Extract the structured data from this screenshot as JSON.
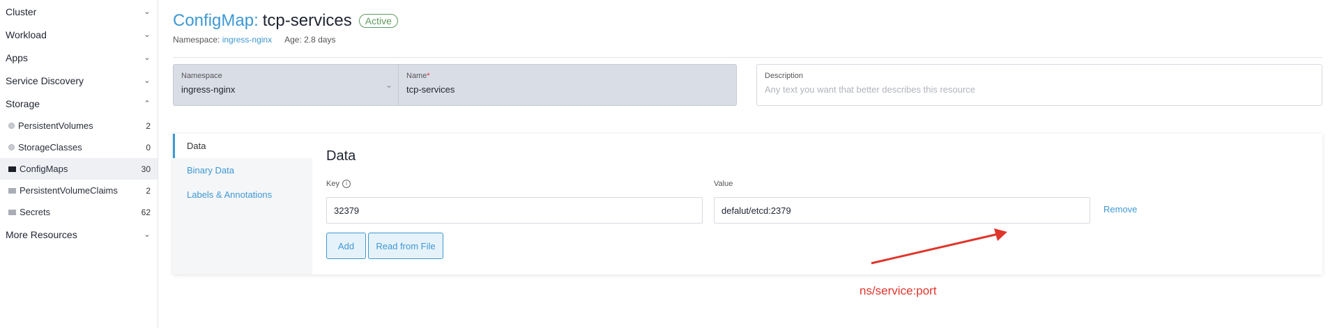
{
  "sidebar": {
    "groups": [
      {
        "label": "Cluster",
        "chevron": "down"
      },
      {
        "label": "Workload",
        "chevron": "down"
      },
      {
        "label": "Apps",
        "chevron": "down"
      },
      {
        "label": "Service Discovery",
        "chevron": "down"
      },
      {
        "label": "Storage",
        "chevron": "up"
      }
    ],
    "storage_items": [
      {
        "label": "PersistentVolumes",
        "count": "2",
        "icon": "circle-icon"
      },
      {
        "label": "StorageClasses",
        "count": "0",
        "icon": "circle-icon"
      },
      {
        "label": "ConfigMaps",
        "count": "30",
        "icon": "folder-icon"
      },
      {
        "label": "PersistentVolumeClaims",
        "count": "2",
        "icon": "folder-icon"
      },
      {
        "label": "Secrets",
        "count": "62",
        "icon": "folder-icon"
      }
    ],
    "more_resources": "More Resources"
  },
  "header": {
    "kind": "ConfigMap:",
    "name": "tcp-services",
    "status": "Active",
    "namespace_label": "Namespace:",
    "namespace_value": "ingress-nginx",
    "age": "Age: 2.8 days"
  },
  "form": {
    "namespace_label": "Namespace",
    "namespace_value": "ingress-nginx",
    "name_label": "Name",
    "name_required": "*",
    "name_value": "tcp-services",
    "description_label": "Description",
    "description_placeholder": "Any text you want that better describes this resource"
  },
  "tabs": [
    {
      "label": "Data"
    },
    {
      "label": "Binary Data"
    },
    {
      "label": "Labels & Annotations"
    }
  ],
  "data_panel": {
    "title": "Data",
    "key_label": "Key",
    "value_label": "Value",
    "rows": [
      {
        "key": "32379",
        "value": "defalut/etcd:2379",
        "remove_label": "Remove"
      }
    ],
    "add_label": "Add",
    "read_file_label": "Read from File"
  },
  "annotation": {
    "text": "ns/service:port",
    "color": "#e0352b"
  },
  "colors": {
    "accent": "#3d98d3",
    "active_badge": "#5d995d"
  }
}
